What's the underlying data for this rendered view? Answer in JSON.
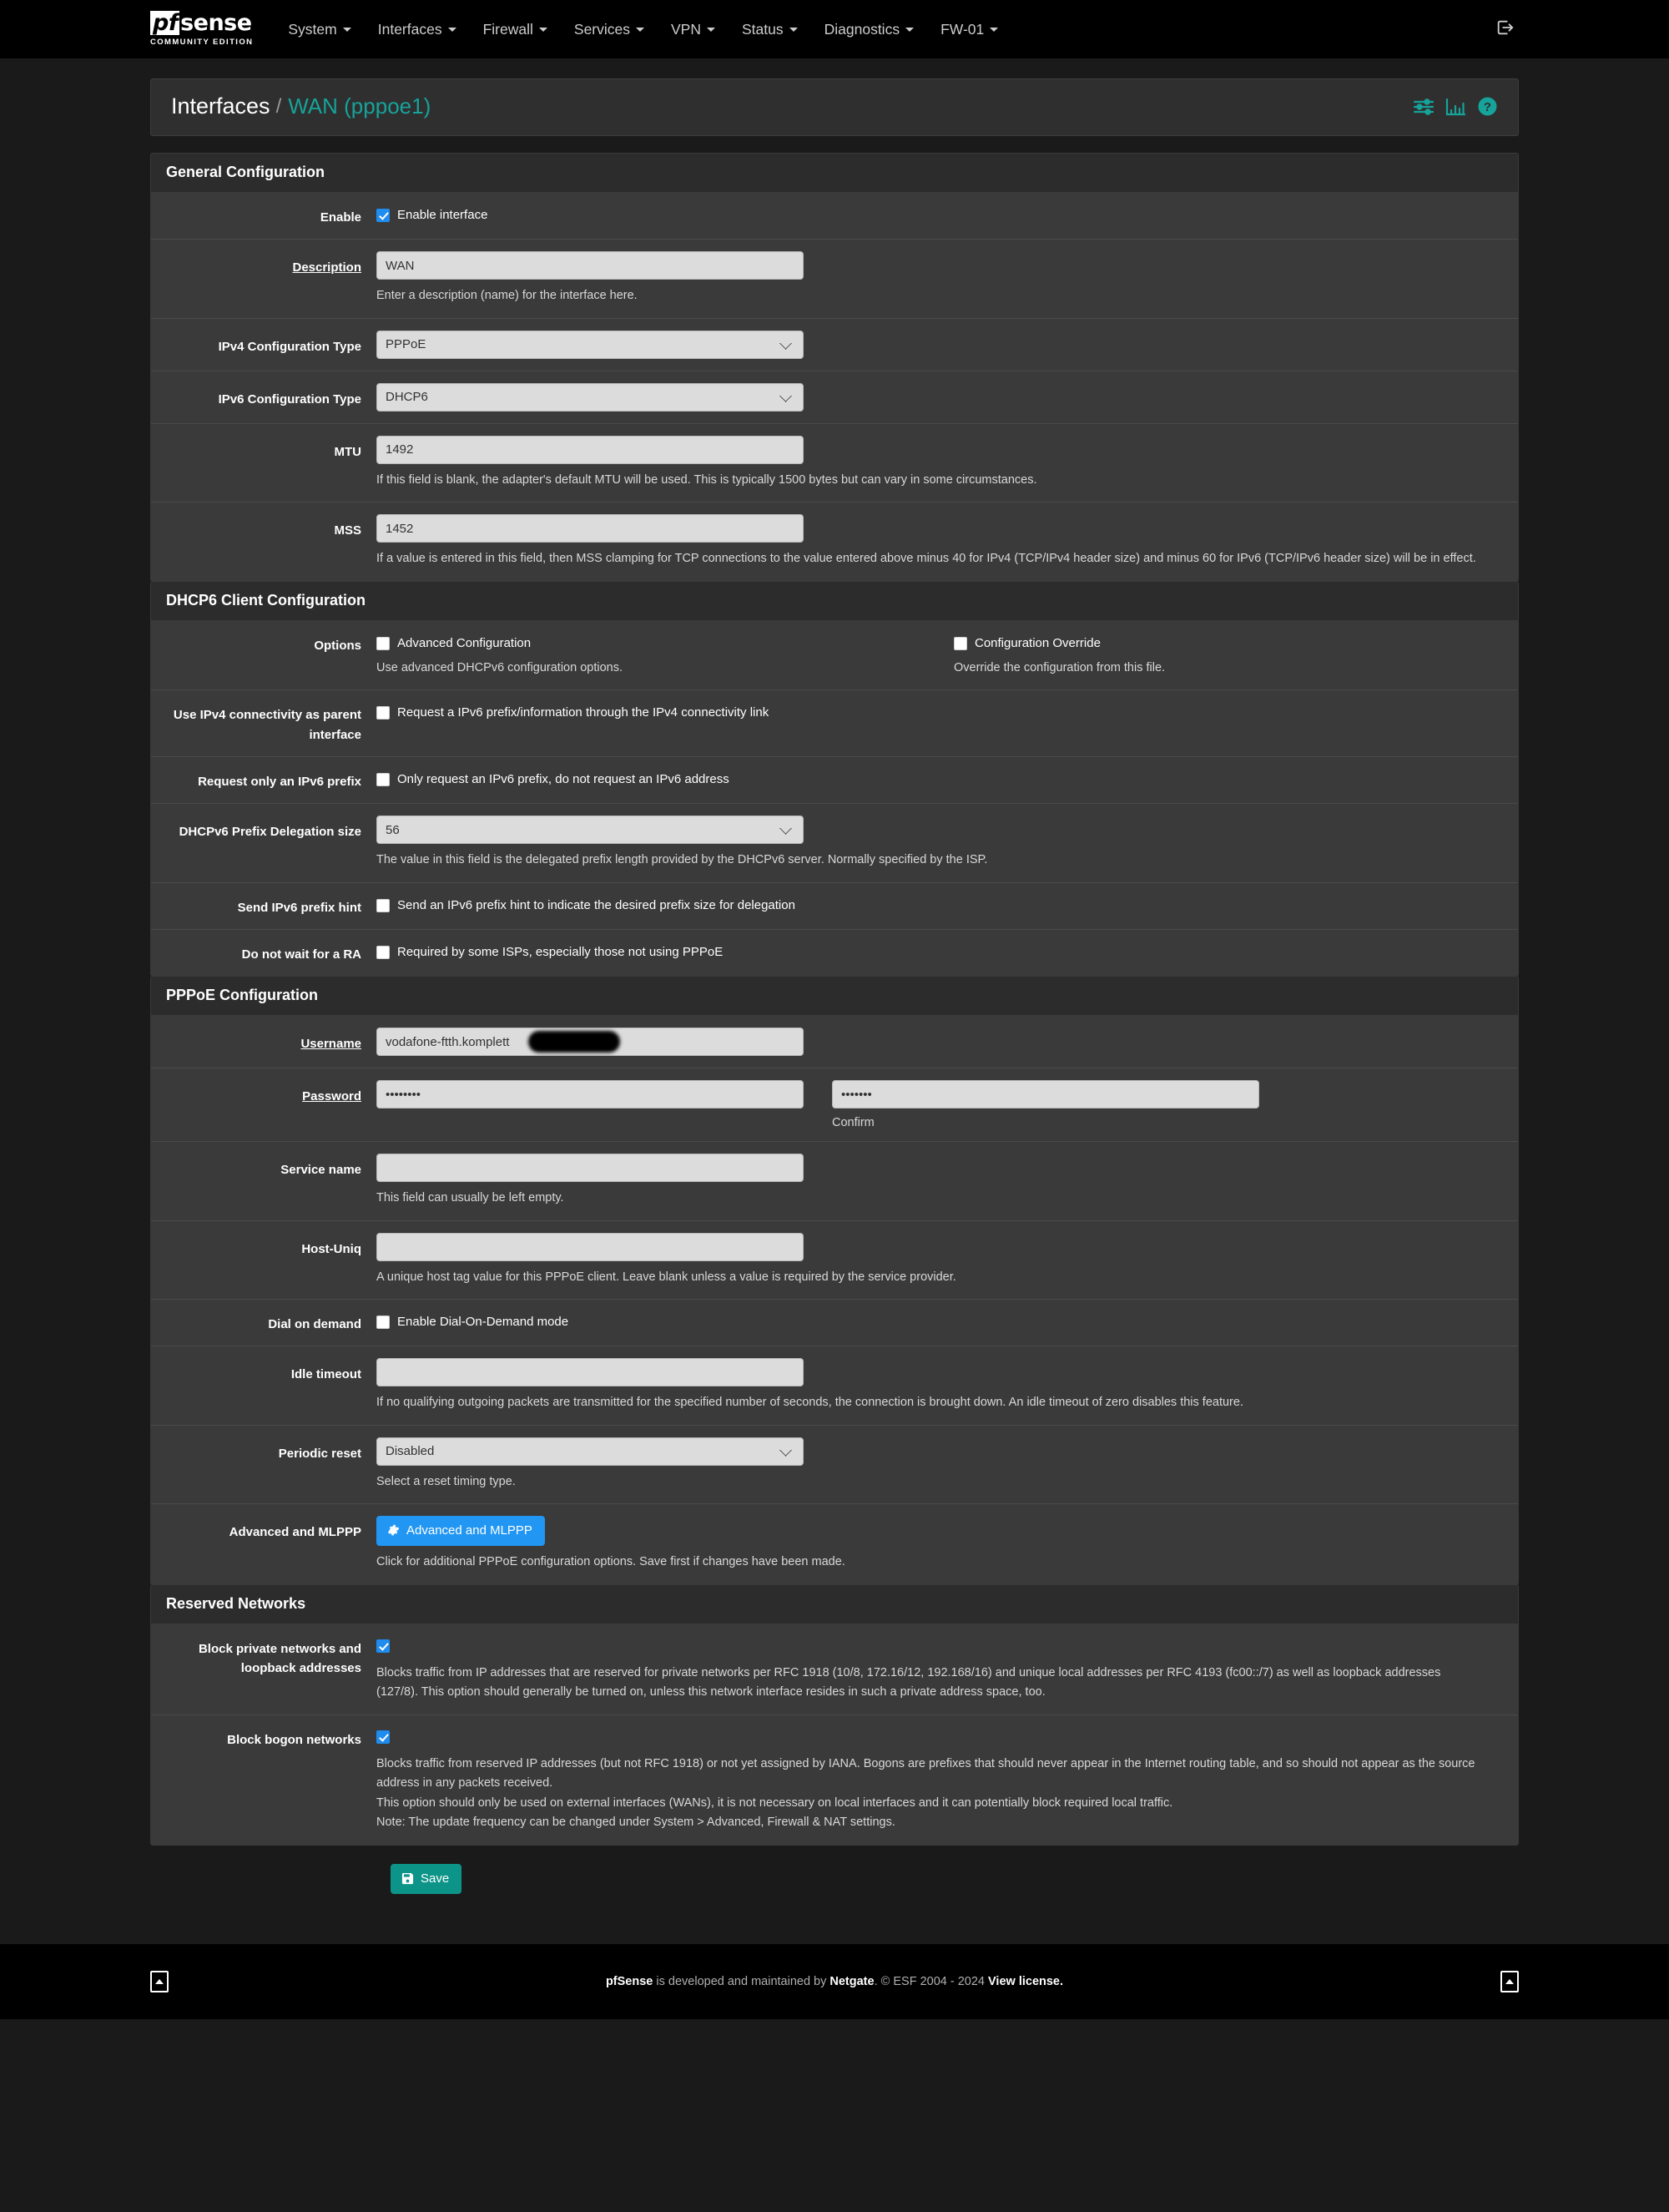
{
  "navbar": {
    "brand": {
      "logo_pf": "pf",
      "logo_sense": "sense",
      "subtitle": "COMMUNITY EDITION"
    },
    "items": [
      {
        "label": "System"
      },
      {
        "label": "Interfaces"
      },
      {
        "label": "Firewall"
      },
      {
        "label": "Services"
      },
      {
        "label": "VPN"
      },
      {
        "label": "Status"
      },
      {
        "label": "Diagnostics"
      },
      {
        "label": "FW-01"
      }
    ],
    "logout_icon": "logout-icon"
  },
  "breadcrumb": {
    "parent": "Interfaces",
    "separator": "/",
    "current": "WAN (pppoe1)",
    "icons": [
      "sliders-icon",
      "bar-chart-icon",
      "help-icon"
    ]
  },
  "colors": {
    "accent_teal": "#16a39a",
    "checkbox_blue": "#1f8cf0",
    "button_info": "#2196f3",
    "button_success": "#0d9488",
    "panel_body": "#3a3a3a",
    "panel_heading": "#2c2c2c",
    "navbar_bg": "#000000"
  },
  "general": {
    "heading": "General Configuration",
    "enable": {
      "label": "Enable",
      "checkbox_label": "Enable interface",
      "checked": true
    },
    "description": {
      "label": "Description",
      "value": "WAN",
      "help": "Enter a description (name) for the interface here."
    },
    "ipv4_type": {
      "label": "IPv4 Configuration Type",
      "value": "PPPoE"
    },
    "ipv6_type": {
      "label": "IPv6 Configuration Type",
      "value": "DHCP6"
    },
    "mtu": {
      "label": "MTU",
      "value": "1492",
      "help": "If this field is blank, the adapter's default MTU will be used. This is typically 1500 bytes but can vary in some circumstances."
    },
    "mss": {
      "label": "MSS",
      "value": "1452",
      "help": "If a value is entered in this field, then MSS clamping for TCP connections to the value entered above minus 40 for IPv4 (TCP/IPv4 header size) and minus 60 for IPv6 (TCP/IPv6 header size) will be in effect."
    }
  },
  "dhcp6": {
    "heading": "DHCP6 Client Configuration",
    "options": {
      "label": "Options",
      "advanced": {
        "checkbox_label": "Advanced Configuration",
        "checked": false,
        "help": "Use advanced DHCPv6 configuration options."
      },
      "override": {
        "checkbox_label": "Configuration Override",
        "checked": false,
        "help": "Override the configuration from this file."
      }
    },
    "parent_interface": {
      "label": "Use IPv4 connectivity as parent interface",
      "checkbox_label": "Request a IPv6 prefix/information through the IPv4 connectivity link",
      "checked": false
    },
    "prefix_only": {
      "label": "Request only an IPv6 prefix",
      "checkbox_label": "Only request an IPv6 prefix, do not request an IPv6 address",
      "checked": false
    },
    "delegation_size": {
      "label": "DHCPv6 Prefix Delegation size",
      "value": "56",
      "help": "The value in this field is the delegated prefix length provided by the DHCPv6 server. Normally specified by the ISP."
    },
    "prefix_hint": {
      "label": "Send IPv6 prefix hint",
      "checkbox_label": "Send an IPv6 prefix hint to indicate the desired prefix size for delegation",
      "checked": false
    },
    "no_ra_wait": {
      "label": "Do not wait for a RA",
      "checkbox_label": "Required by some ISPs, especially those not using PPPoE",
      "checked": false
    }
  },
  "pppoe": {
    "heading": "PPPoE Configuration",
    "username": {
      "label": "Username",
      "value": "vodafone-ftth.komplett",
      "redacted": true
    },
    "password": {
      "label": "Password",
      "value": "••••••••",
      "confirm_value": "•••••••",
      "confirm_label": "Confirm"
    },
    "service_name": {
      "label": "Service name",
      "value": "",
      "help": "This field can usually be left empty."
    },
    "host_uniq": {
      "label": "Host-Uniq",
      "value": "",
      "help": "A unique host tag value for this PPPoE client. Leave blank unless a value is required by the service provider."
    },
    "dial_on_demand": {
      "label": "Dial on demand",
      "checkbox_label": "Enable Dial-On-Demand mode",
      "checked": false
    },
    "idle_timeout": {
      "label": "Idle timeout",
      "value": "",
      "help": "If no qualifying outgoing packets are transmitted for the specified number of seconds, the connection is brought down. An idle timeout of zero disables this feature."
    },
    "periodic_reset": {
      "label": "Periodic reset",
      "value": "Disabled",
      "help": "Select a reset timing type."
    },
    "advanced_mlppp": {
      "label": "Advanced and MLPPP",
      "button_label": "Advanced and MLPPP",
      "help": "Click for additional PPPoE configuration options. Save first if changes have been made."
    }
  },
  "reserved": {
    "heading": "Reserved Networks",
    "block_private": {
      "label": "Block private networks and loopback addresses",
      "checked": true,
      "help": "Blocks traffic from IP addresses that are reserved for private networks per RFC 1918 (10/8, 172.16/12, 192.168/16) and unique local addresses per RFC 4193 (fc00::/7) as well as loopback addresses (127/8). This option should generally be turned on, unless this network interface resides in such a private address space, too."
    },
    "block_bogon": {
      "label": "Block bogon networks",
      "checked": true,
      "help_line1": "Blocks traffic from reserved IP addresses (but not RFC 1918) or not yet assigned by IANA. Bogons are prefixes that should never appear in the Internet routing table, and so should not appear as the source address in any packets received.",
      "help_line2": "This option should only be used on external interfaces (WANs), it is not necessary on local interfaces and it can potentially block required local traffic.",
      "help_line3": "Note: The update frequency can be changed under System > Advanced, Firewall & NAT settings."
    }
  },
  "actions": {
    "save_label": "Save"
  },
  "footer": {
    "product": "pfSense",
    "text_mid": " is developed and maintained by ",
    "company": "Netgate",
    "copyright": ". © ESF 2004 - 2024 ",
    "license_link": "View license."
  }
}
